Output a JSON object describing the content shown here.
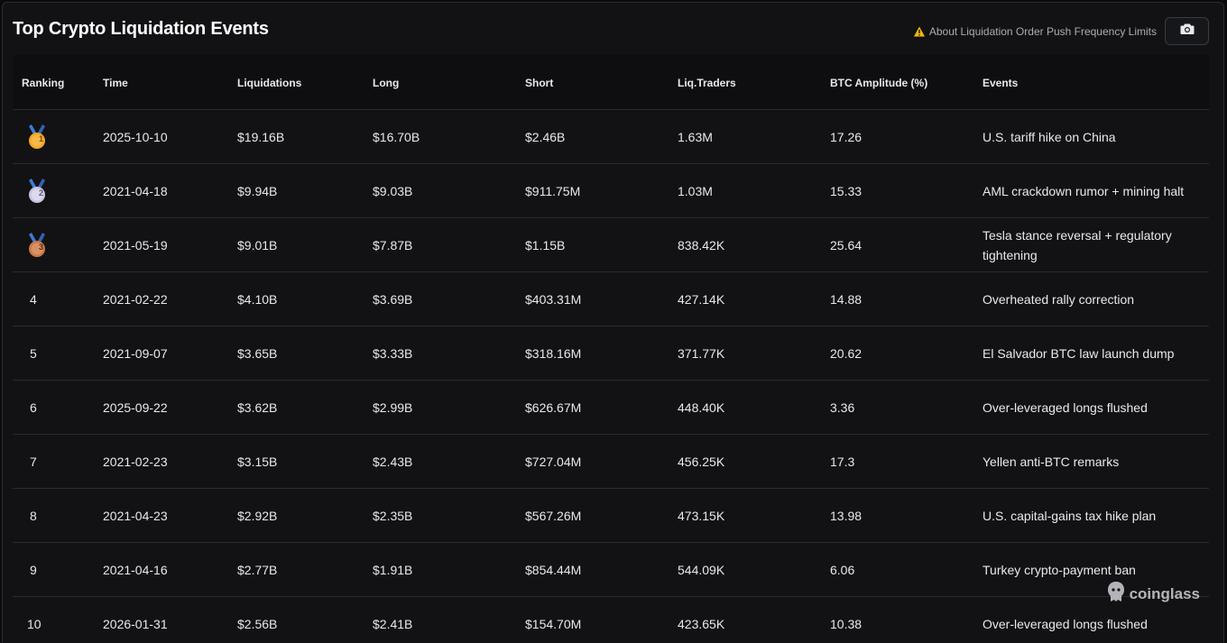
{
  "header": {
    "title": "Top Crypto Liquidation Events",
    "notice": "About Liquidation Order Push Frequency Limits"
  },
  "table": {
    "columns": [
      "Ranking",
      "Time",
      "Liquidations",
      "Long",
      "Short",
      "Liq.Traders",
      "BTC Amplitude (%)",
      "Events"
    ],
    "rows": [
      {
        "rank": "1",
        "time": "2025-10-10",
        "liq": "$19.16B",
        "long": "$16.70B",
        "short": "$2.46B",
        "traders": "1.63M",
        "amp": "17.26",
        "event": "U.S. tariff hike on China"
      },
      {
        "rank": "2",
        "time": "2021-04-18",
        "liq": "$9.94B",
        "long": "$9.03B",
        "short": "$911.75M",
        "traders": "1.03M",
        "amp": "15.33",
        "event": "AML crackdown rumor + mining halt"
      },
      {
        "rank": "3",
        "time": "2021-05-19",
        "liq": "$9.01B",
        "long": "$7.87B",
        "short": "$1.15B",
        "traders": "838.42K",
        "amp": "25.64",
        "event": "Tesla stance reversal + regulatory tightening"
      },
      {
        "rank": "4",
        "time": "2021-02-22",
        "liq": "$4.10B",
        "long": "$3.69B",
        "short": "$403.31M",
        "traders": "427.14K",
        "amp": "14.88",
        "event": "Overheated rally correction"
      },
      {
        "rank": "5",
        "time": "2021-09-07",
        "liq": "$3.65B",
        "long": "$3.33B",
        "short": "$318.16M",
        "traders": "371.77K",
        "amp": "20.62",
        "event": "El Salvador BTC law launch dump"
      },
      {
        "rank": "6",
        "time": "2025-09-22",
        "liq": "$3.62B",
        "long": "$2.99B",
        "short": "$626.67M",
        "traders": "448.40K",
        "amp": "3.36",
        "event": "Over-leveraged longs flushed"
      },
      {
        "rank": "7",
        "time": "2021-02-23",
        "liq": "$3.15B",
        "long": "$2.43B",
        "short": "$727.04M",
        "traders": "456.25K",
        "amp": "17.3",
        "event": "Yellen anti-BTC remarks"
      },
      {
        "rank": "8",
        "time": "2021-04-23",
        "liq": "$2.92B",
        "long": "$2.35B",
        "short": "$567.26M",
        "traders": "473.15K",
        "amp": "13.98",
        "event": "U.S. capital-gains tax hike plan"
      },
      {
        "rank": "9",
        "time": "2021-04-16",
        "liq": "$2.77B",
        "long": "$1.91B",
        "short": "$854.44M",
        "traders": "544.09K",
        "amp": "6.06",
        "event": "Turkey crypto-payment ban"
      },
      {
        "rank": "10",
        "time": "2026-01-31",
        "liq": "$2.56B",
        "long": "$2.41B",
        "short": "$154.70M",
        "traders": "423.65K",
        "amp": "10.38",
        "event": "Over-leveraged longs flushed"
      }
    ]
  },
  "watermark": "coinglass",
  "icons": {
    "notice": "warning-icon",
    "button": "camera-icon",
    "medals": [
      "gold-medal-icon",
      "silver-medal-icon",
      "bronze-medal-icon"
    ]
  },
  "colors": {
    "background": "#121214",
    "warning": "#f0b90b",
    "gold": "#f5a623",
    "silver": "#c9c4e0",
    "bronze": "#c8794a",
    "ribbon": "#3d7bd8"
  }
}
